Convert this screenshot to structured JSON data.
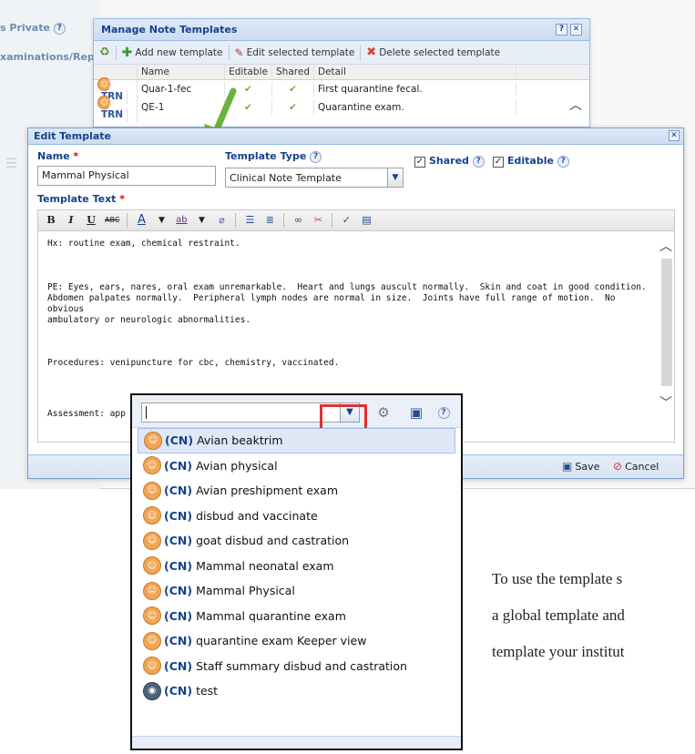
{
  "background": {
    "private_label": "s Private",
    "exams_label": "xaminations/Rep"
  },
  "manage_window": {
    "title": "Manage Note Templates",
    "toolbar": {
      "add": "Add new template",
      "edit": "Edit selected template",
      "delete": "Delete selected template"
    },
    "columns": [
      "Name",
      "Editable",
      "Shared",
      "Detail"
    ],
    "rows": [
      {
        "tag": "TRN",
        "name": "Quar-1-fec",
        "detail": "First quarantine fecal."
      },
      {
        "tag": "TRN",
        "name": "QE-1",
        "detail": "Quarantine exam."
      }
    ]
  },
  "edit_dialog": {
    "title": "Edit Template",
    "name_label": "Name",
    "name_value": "Mammal Physical",
    "type_label": "Template Type",
    "type_value": "Clinical Note Template",
    "shared_label": "Shared",
    "editable_label": "Editable",
    "text_label": "Template Text",
    "required_mark": "*",
    "toolbar": {
      "bold": "B",
      "italic": "I",
      "underline": "U",
      "strike": "ABC",
      "font_color": "A",
      "highlight": "ab",
      "eraser": "⌀"
    },
    "body": [
      "Hx: routine exam, chemical restraint.",
      "PE: Eyes, ears, nares, oral exam unremarkable.  Heart and lungs auscult normally.  Skin and coat in good condition.\nAbdomen palpates normally.  Peripheral lymph nodes are normal in size.  Joints have full range of motion.  No obvious\nambulatory or neurologic abnormalities.",
      "Procedures: venipuncture for cbc, chemistry, vaccinated.",
      "Assessment: app"
    ],
    "save": "Save",
    "cancel": "Cancel"
  },
  "picker": {
    "input_value": "",
    "prefix": "(CN)",
    "items": [
      "Avian beaktrim",
      "Avian physical",
      "Avian preshipment exam",
      "disbud and vaccinate",
      "goat disbud and castration",
      "Mammal neonatal exam",
      "Mammal Physical",
      "Mammal quarantine exam",
      "quarantine exam Keeper view",
      "Staff summary disbud and castration",
      "test"
    ]
  },
  "doc_text": [
    "To use the template s",
    "a global template and",
    "template your institut"
  ],
  "colors": {
    "title_blue": "#15428b",
    "highlight_red": "#e03030",
    "arrow_green": "#6bb23a",
    "required_red": "#dd0000"
  }
}
